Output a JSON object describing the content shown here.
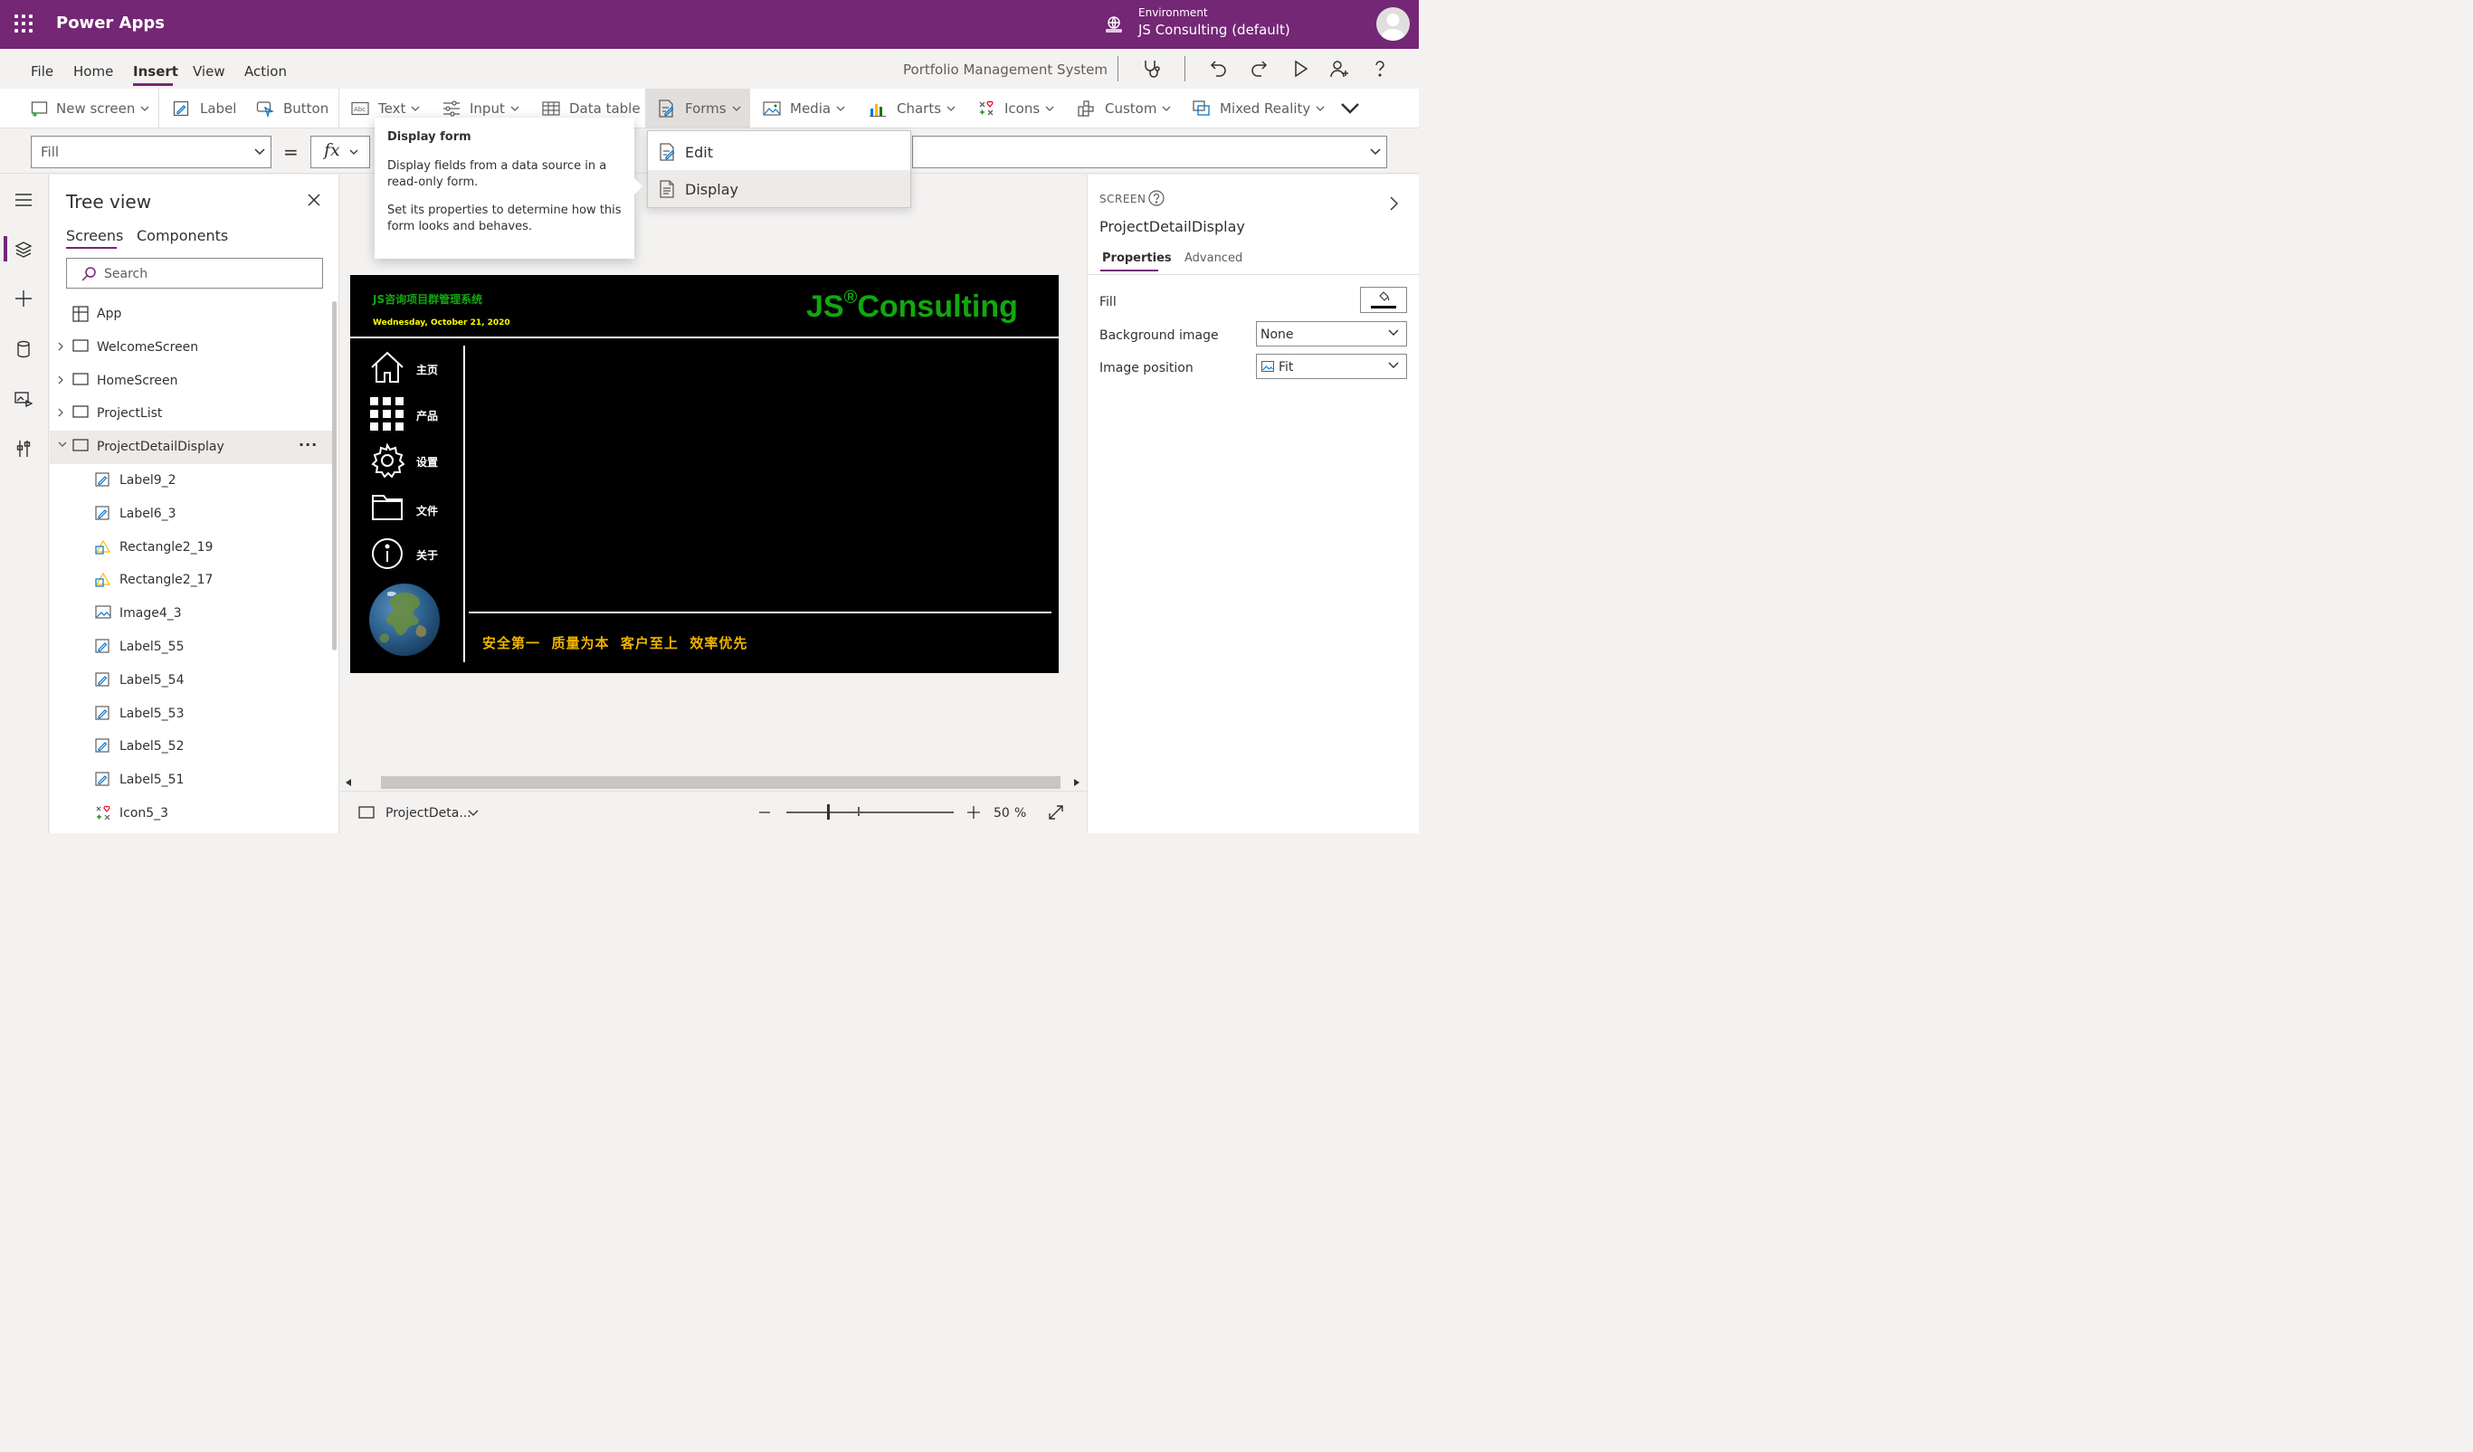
{
  "header": {
    "app_title": "Power Apps",
    "environment_label": "Environment",
    "environment_name": "JS Consulting (default)"
  },
  "menu": {
    "tabs": [
      "File",
      "Home",
      "Insert",
      "View",
      "Action"
    ],
    "active_tab": "Insert",
    "document_title": "Portfolio Management System"
  },
  "ribbon": {
    "new_screen": "New screen",
    "label": "Label",
    "button": "Button",
    "text": "Text",
    "input": "Input",
    "data_table": "Data table",
    "forms": "Forms",
    "media": "Media",
    "charts": "Charts",
    "icons": "Icons",
    "custom": "Custom",
    "mixed_reality": "Mixed Reality"
  },
  "formula_bar": {
    "property": "Fill",
    "equals": "=",
    "fx": "fx",
    "formula": ""
  },
  "tooltip": {
    "title": "Display form",
    "description1": "Display fields from a data source in a read-only form.",
    "description2": "Set its properties to determine how this form looks and behaves."
  },
  "forms_menu": {
    "items": [
      "Edit",
      "Display"
    ],
    "highlighted": "Display"
  },
  "tree_view": {
    "title": "Tree view",
    "tabs": [
      "Screens",
      "Components"
    ],
    "active_tab": "Screens",
    "search_placeholder": "Search",
    "items": [
      {
        "label": "App",
        "type": "app",
        "level": 0
      },
      {
        "label": "WelcomeScreen",
        "type": "screen",
        "level": 0
      },
      {
        "label": "HomeScreen",
        "type": "screen",
        "level": 0
      },
      {
        "label": "ProjectList",
        "type": "screen",
        "level": 0
      },
      {
        "label": "ProjectDetailDisplay",
        "type": "screen",
        "level": 0,
        "selected": true,
        "expanded": true,
        "more": "···"
      },
      {
        "label": "Label9_2",
        "type": "label",
        "level": 1
      },
      {
        "label": "Label6_3",
        "type": "label",
        "level": 1
      },
      {
        "label": "Rectangle2_19",
        "type": "shape",
        "level": 1
      },
      {
        "label": "Rectangle2_17",
        "type": "shape",
        "level": 1
      },
      {
        "label": "Image4_3",
        "type": "image",
        "level": 1
      },
      {
        "label": "Label5_55",
        "type": "label",
        "level": 1
      },
      {
        "label": "Label5_54",
        "type": "label",
        "level": 1
      },
      {
        "label": "Label5_53",
        "type": "label",
        "level": 1
      },
      {
        "label": "Label5_52",
        "type": "label",
        "level": 1
      },
      {
        "label": "Label5_51",
        "type": "label",
        "level": 1
      },
      {
        "label": "Icon5_3",
        "type": "icon",
        "level": 1
      }
    ]
  },
  "app_canvas": {
    "system_name": "JS咨询项目群管理系统",
    "date": "Wednesday, October 21, 2020",
    "logo_text": "JS",
    "logo_reg": "®",
    "logo_suffix": "Consulting",
    "nav": [
      {
        "label": "主页",
        "icon": "home-icon"
      },
      {
        "label": "产品",
        "icon": "grid-icon"
      },
      {
        "label": "设置",
        "icon": "gear-icon"
      },
      {
        "label": "文件",
        "icon": "folder-icon"
      },
      {
        "label": "关于",
        "icon": "info-icon"
      }
    ],
    "slogan": "安全第一  质量为本  客户至上  效率优先"
  },
  "status_bar": {
    "screen_name": "ProjectDeta...",
    "zoom_value": "50",
    "zoom_unit": "%"
  },
  "right_panel": {
    "kind": "SCREEN",
    "name": "ProjectDetailDisplay",
    "tabs": [
      "Properties",
      "Advanced"
    ],
    "active_tab": "Properties",
    "fill_label": "Fill",
    "background_image_label": "Background image",
    "background_image_value": "None",
    "image_position_label": "Image position",
    "image_position_value": "Fit"
  },
  "colors": {
    "brand": "#742774",
    "canvas_bg": "#000000",
    "logo_green": "#10a810",
    "date_yellow": "#ffff00",
    "slogan_gold": "#f0b400"
  }
}
